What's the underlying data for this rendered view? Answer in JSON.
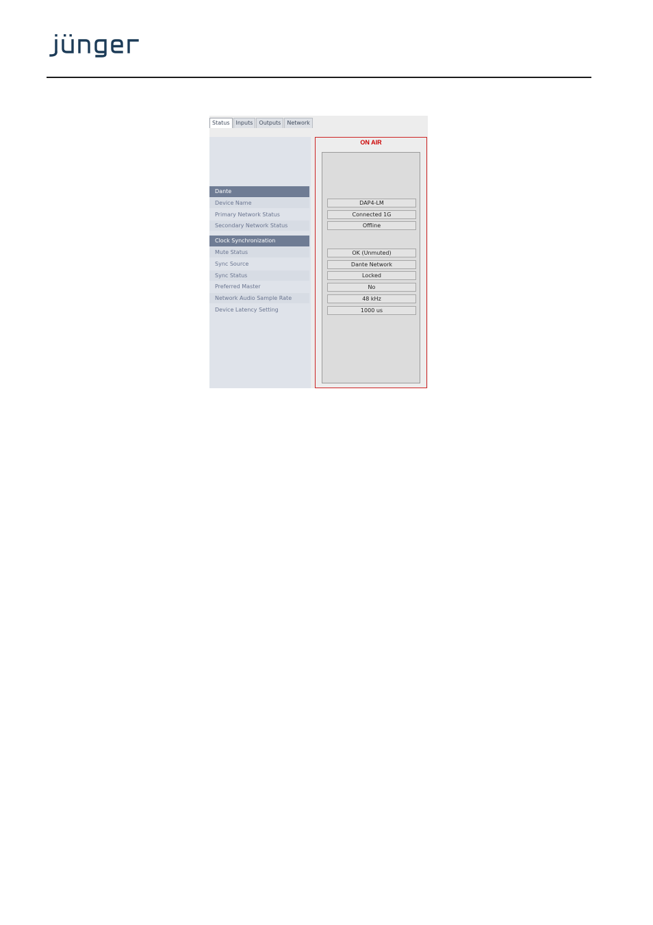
{
  "brand": {
    "logo_text": "jünger",
    "color": "#1c3b57"
  },
  "tabs": [
    "Status",
    "Inputs",
    "Outputs",
    "Network"
  ],
  "status": {
    "on_air_label": "ON AIR",
    "sections": [
      {
        "title": "Dante",
        "rows": [
          {
            "label": "Device Name",
            "value": "DAP4-LM"
          },
          {
            "label": "Primary Network Status",
            "value": "Connected 1G"
          },
          {
            "label": "Secondary Network Status",
            "value": "Offline"
          }
        ]
      },
      {
        "title": "Clock Synchronization",
        "rows": [
          {
            "label": "Mute Status",
            "value": "OK (Unmuted)"
          },
          {
            "label": "Sync Source",
            "value": "Dante Network"
          },
          {
            "label": "Sync Status",
            "value": "Locked"
          },
          {
            "label": "Preferred Master",
            "value": "No"
          },
          {
            "label": "Network Audio Sample Rate",
            "value": "48 kHz"
          },
          {
            "label": "Device Latency Setting",
            "value": "1000 us"
          }
        ]
      }
    ]
  },
  "colors": {
    "on_air": "#cc0000",
    "section_header": "#6f7c94",
    "label_text": "#6a7590"
  }
}
